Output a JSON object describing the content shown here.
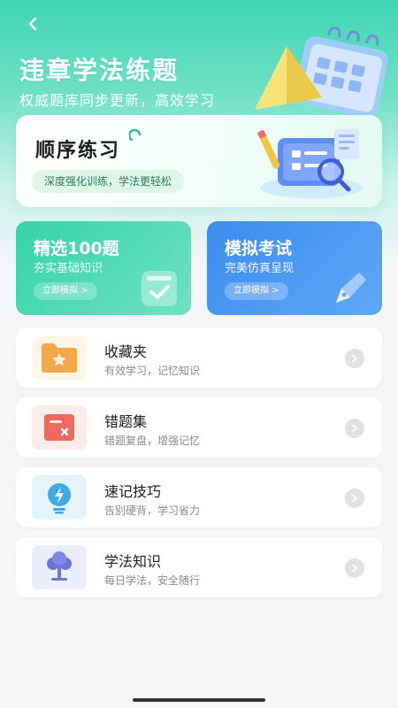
{
  "header": {
    "back_icon": "chevron-left-icon",
    "title": "违章学法练题",
    "subtitle": "权威题库同步更新，高效学习"
  },
  "sequential": {
    "title": "顺序练习",
    "badge": "深度强化训练，学法更轻松"
  },
  "quick_cards": [
    {
      "title": "精选100题",
      "subtitle": "夯实基础知识",
      "button": "立即模拟 >",
      "color": "#34d3a8"
    },
    {
      "title": "模拟考试",
      "subtitle": "完美仿真呈现",
      "button": "立即模拟 >",
      "color": "#3c8cf0"
    }
  ],
  "list": [
    {
      "title": "收藏夹",
      "subtitle": "有效学习，记忆知识",
      "icon": "folder-star-icon"
    },
    {
      "title": "错题集",
      "subtitle": "错题复盘，增强记忆",
      "icon": "wrong-card-icon"
    },
    {
      "title": "速记技巧",
      "subtitle": "告别硬背，学习省力",
      "icon": "lightbulb-icon"
    },
    {
      "title": "学法知识",
      "subtitle": "每日学法，安全随行",
      "icon": "tree-icon"
    }
  ]
}
